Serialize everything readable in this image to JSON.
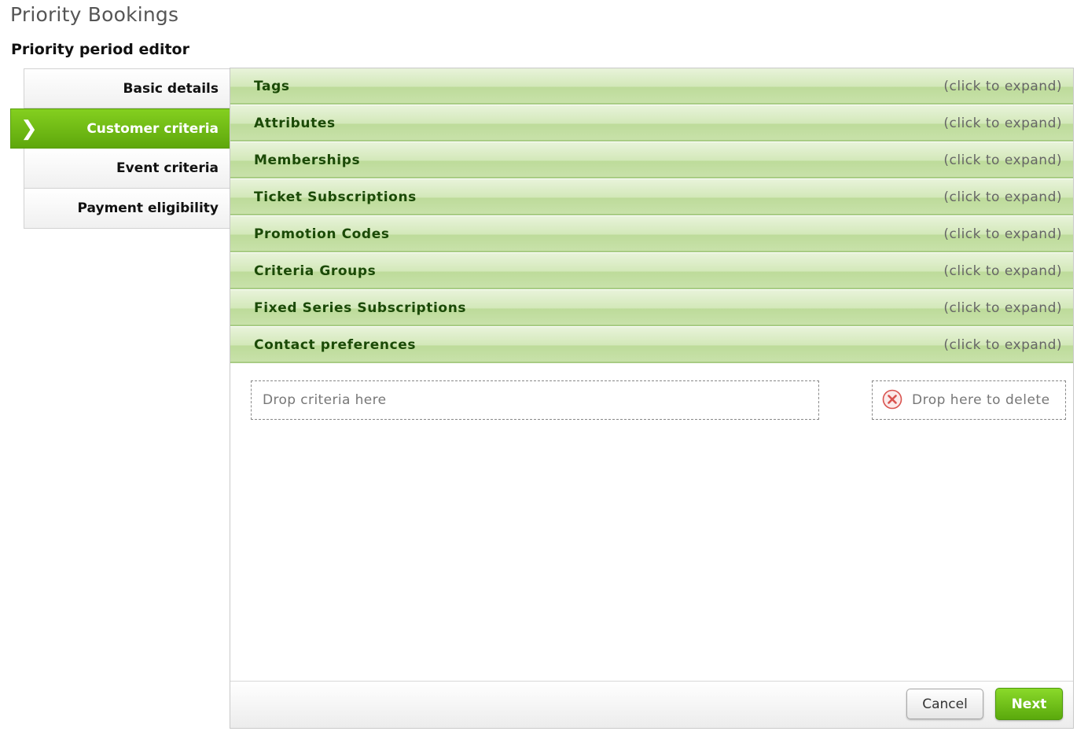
{
  "app": {
    "title": "Priority Bookings"
  },
  "editor": {
    "title": "Priority period editor"
  },
  "nav": {
    "items": [
      {
        "label": "Basic details",
        "active": false
      },
      {
        "label": "Customer criteria",
        "active": true,
        "icon": "chevron-right-icon"
      },
      {
        "label": "Event criteria",
        "active": false
      },
      {
        "label": "Payment eligibility",
        "active": false
      }
    ]
  },
  "sections": [
    {
      "label": "Tags",
      "hint": "(click to expand)"
    },
    {
      "label": "Attributes",
      "hint": "(click to expand)"
    },
    {
      "label": "Memberships",
      "hint": "(click to expand)"
    },
    {
      "label": "Ticket Subscriptions",
      "hint": "(click to expand)"
    },
    {
      "label": "Promotion Codes",
      "hint": "(click to expand)"
    },
    {
      "label": "Criteria Groups",
      "hint": "(click to expand)"
    },
    {
      "label": "Fixed Series Subscriptions",
      "hint": "(click to expand)"
    },
    {
      "label": "Contact preferences",
      "hint": "(click to expand)"
    }
  ],
  "drop_zones": {
    "criteria_label": "Drop criteria here",
    "delete_label": "Drop here to delete",
    "delete_icon": "close-circle-icon"
  },
  "footer": {
    "cancel_label": "Cancel",
    "next_label": "Next"
  },
  "colors": {
    "accent": "#6fbb15",
    "section_text": "#1b4a07",
    "section_bg": "#d3e8b9",
    "delete_icon": "#d9534f"
  }
}
